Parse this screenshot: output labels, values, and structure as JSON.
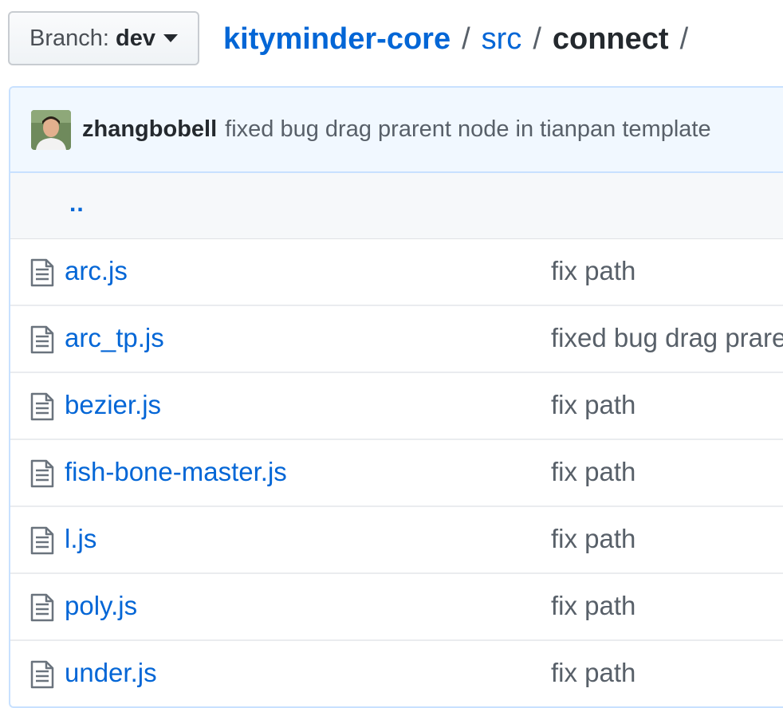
{
  "branch": {
    "label": "Branch:",
    "value": "dev"
  },
  "breadcrumb": {
    "repo": "kityminder-core",
    "folder": "src",
    "current": "connect",
    "separator": "/"
  },
  "commit": {
    "author": "zhangbobell",
    "message": "fixed bug drag prarent node in tianpan template"
  },
  "parent_link": "..",
  "files": [
    {
      "name": "arc.js",
      "message": "fix path"
    },
    {
      "name": "arc_tp.js",
      "message": "fixed bug drag prarent node in tianpan template"
    },
    {
      "name": "bezier.js",
      "message": "fix path"
    },
    {
      "name": "fish-bone-master.js",
      "message": "fix path"
    },
    {
      "name": "l.js",
      "message": "fix path"
    },
    {
      "name": "poly.js",
      "message": "fix path"
    },
    {
      "name": "under.js",
      "message": "fix path"
    }
  ],
  "icons": {
    "file": "file-text-icon",
    "caret": "caret-down-icon"
  },
  "colors": {
    "link": "#0366d6",
    "muted": "#586069",
    "header_bg": "#f1f8ff",
    "border": "#c8e1ff"
  }
}
